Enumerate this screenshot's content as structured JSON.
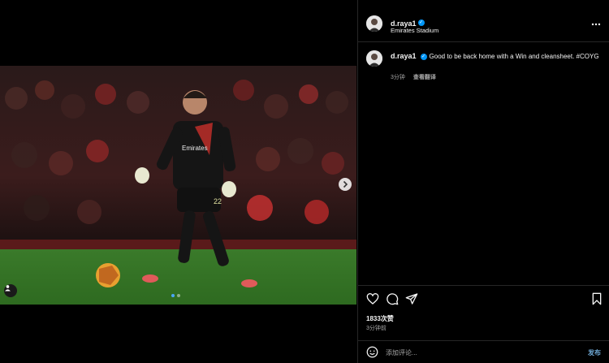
{
  "post": {
    "username": "d.raya1",
    "location": "Emirates Stadium",
    "caption_text": "Good to be back home with a Win and cleansheet. #COYG",
    "time_ago": "3分钟",
    "translate_label": "查看翻译",
    "likes": "1833次赞",
    "posted_ago": "3分钟前",
    "comment_placeholder": "添加评论...",
    "post_button": "发布",
    "carousel": {
      "total": 2,
      "current": 1
    },
    "jersey_sponsor": "Emirates",
    "jersey_number": "22"
  },
  "icons": {
    "more": "more-options-icon",
    "like": "heart-icon",
    "comment": "comment-icon",
    "share": "send-icon",
    "save": "bookmark-icon",
    "emoji": "emoji-icon",
    "next": "chevron-right-icon",
    "tag": "person-tag-icon"
  },
  "colors": {
    "verified": "#0095f6",
    "background": "#000000",
    "muted": "#a8a8a8"
  }
}
